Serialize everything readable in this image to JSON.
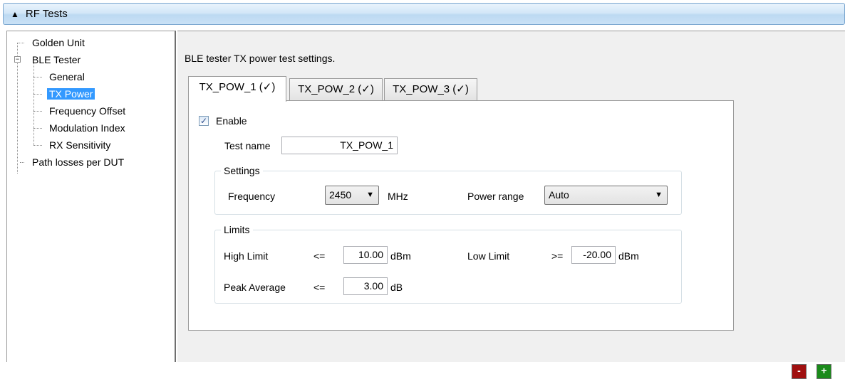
{
  "titlebar": {
    "collapse_icon": "▲",
    "title": "RF Tests"
  },
  "tree": {
    "items": [
      {
        "label": "Golden Unit"
      },
      {
        "label": "BLE Tester",
        "expander": "−"
      },
      {
        "label": "General"
      },
      {
        "label": "TX Power"
      },
      {
        "label": "Frequency Offset"
      },
      {
        "label": "Modulation Index"
      },
      {
        "label": "RX Sensitivity"
      },
      {
        "label": "Path losses per DUT"
      }
    ]
  },
  "panel": {
    "description": "BLE tester TX power test settings.",
    "tabs": [
      {
        "label": "TX_POW_1 (✓)"
      },
      {
        "label": "TX_POW_2 (✓)"
      },
      {
        "label": "TX_POW_3 (✓)"
      }
    ],
    "enable": {
      "label": "Enable",
      "checked_glyph": "✓"
    },
    "test_name": {
      "label": "Test name",
      "value": "TX_POW_1"
    },
    "settings": {
      "legend": "Settings",
      "frequency_label": "Frequency",
      "frequency_value": "2450",
      "frequency_unit": "MHz",
      "power_range_label": "Power range",
      "power_range_value": "Auto"
    },
    "limits": {
      "legend": "Limits",
      "high_label": "High Limit",
      "high_op": "<=",
      "high_value": "10.00",
      "high_unit": "dBm",
      "low_label": "Low Limit",
      "low_op": ">=",
      "low_value": "-20.00",
      "low_unit": "dBm",
      "peak_label": "Peak Average",
      "peak_op": "<=",
      "peak_value": "3.00",
      "peak_unit": "dB"
    }
  },
  "buttons": {
    "remove_label": "-",
    "add_label": "+"
  },
  "colors": {
    "remove": "#a01010",
    "add": "#1a8a1a",
    "selection": "#3399ff"
  }
}
